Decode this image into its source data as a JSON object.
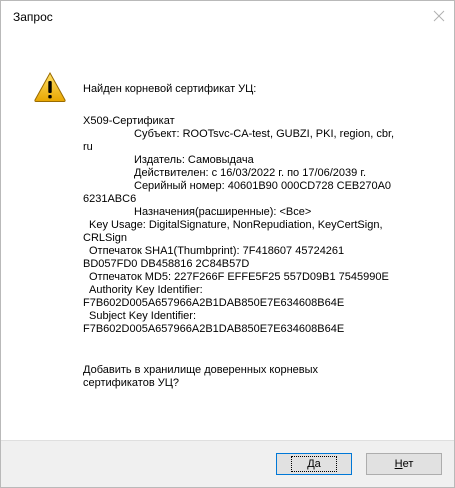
{
  "dialog": {
    "title": "Запрос",
    "heading": "Найден корневой сертификат УЦ:",
    "lines": [
      {
        "text": "X509-Сертификат"
      },
      {
        "text": "Субъект: ROOTsvc-CA-test, GUBZI, PKI, region, cbr,"
      },
      {
        "text": "ru"
      },
      {
        "text": "Издатель: Самовыдача"
      },
      {
        "text": "Действителен: с 16/03/2022 г. по 17/06/2039 г."
      },
      {
        "text": "Серийный номер: 40601B90 000CD728 CEB270A0"
      },
      {
        "text": "6231ABC6"
      },
      {
        "text": "Назначения(расширенные): <Все>"
      },
      {
        "text": "Key Usage: DigitalSignature, NonRepudiation, KeyCertSign,"
      },
      {
        "text": "CRLSign"
      },
      {
        "text": "Отпечаток SHA1(Thumbprint): 7F418607 45724261"
      },
      {
        "text": "BD057FD0 DB458816 2C84B57D"
      },
      {
        "text": "Отпечаток MD5: 227F266F EFFE5F25 557D09B1 7545990E"
      },
      {
        "text": "Authority Key Identifier:"
      },
      {
        "text": "F7B602D005A657966A2B1DAB850E7E634608B64E"
      },
      {
        "text": "Subject Key Identifier:"
      },
      {
        "text": "F7B602D005A657966A2B1DAB850E7E634608B64E"
      }
    ],
    "question_line1": "Добавить в хранилище доверенных корневых",
    "question_line2": "сертификатов УЦ?",
    "buttons": {
      "yes_mnemonic": "Д",
      "yes_rest": "а",
      "no_mnemonic": "Н",
      "no_rest": "ет"
    }
  }
}
